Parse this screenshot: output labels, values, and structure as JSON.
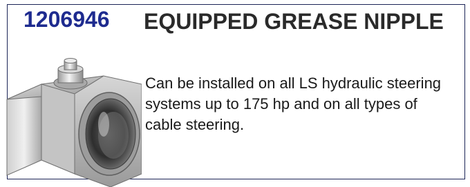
{
  "product": {
    "part_number": "1206946",
    "title": "EQUIPPED GREASE NIPPLE",
    "description": "Can be installed on all LS hydraulic steering systems up to 175 hp and on all types of cable steering."
  },
  "colors": {
    "part_number": "#1e2b8f",
    "border": "#1b2456",
    "title": "#2a2a2a"
  },
  "image": {
    "subject": "grease-nipple-fitting"
  }
}
